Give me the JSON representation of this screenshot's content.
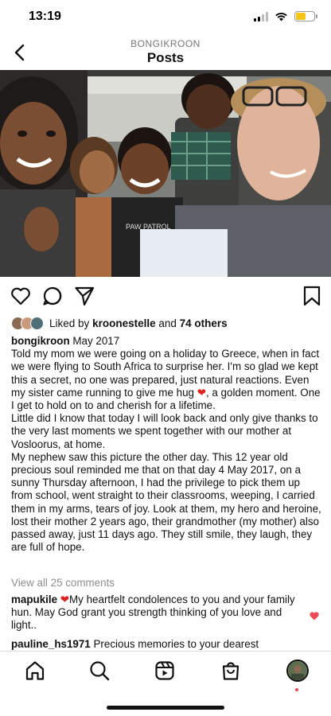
{
  "status_bar": {
    "time": "13:19"
  },
  "header": {
    "username": "BONGIKROON",
    "title": "Posts"
  },
  "likes": {
    "prefix": "Liked by",
    "user": "kroonestelle",
    "conjunction": "and",
    "others": "74 others"
  },
  "caption": {
    "username": "bongikroon",
    "date": "May 2017",
    "para1_a": "Told my mom we were going on a holiday to Greece, when in fact we were flying to South Africa to surprise her. I'm so glad we kept this a secret, no one was prepared, just natural reactions. Even my sister came running to give me hug",
    "para1_b": ", a golden moment. One I get to hold on to and cherish for a lifetime.",
    "para2": "Little did I know that today I will look back and only give thanks to the very last moments we spent together with our mother at Vosloorus, at home.",
    "para3": "My nephew saw this picture the other day. This 12 year old precious soul reminded me that on that day 4 May 2017, on a sunny Thursday afternoon, I had the privilege to pick them up from school, went straight to their classrooms, weeping, I carried them in my arms, tears of joy. Look at them, my hero and heroine, lost their mother 2 years ago, their grandmother (my mother) also passed away, just 11 days ago. They still smile, they laugh, they are full of hope."
  },
  "view_comments": "View all 25 comments",
  "comments": [
    {
      "username": "mapukile",
      "text": "My heartfelt condolences to you and your family hun. May God grant you strength thinking of you love and light.."
    },
    {
      "username": "pauline_hs1971",
      "text": "Precious memories to your dearest"
    }
  ],
  "colors": {
    "heart": "#ed4956",
    "muted": "#8e8e8e",
    "battery": "#f5c518"
  },
  "icons": [
    "back-arrow-icon",
    "heart-icon",
    "comment-icon",
    "share-icon",
    "bookmark-icon",
    "home-icon",
    "search-icon",
    "reels-icon",
    "shop-icon"
  ]
}
